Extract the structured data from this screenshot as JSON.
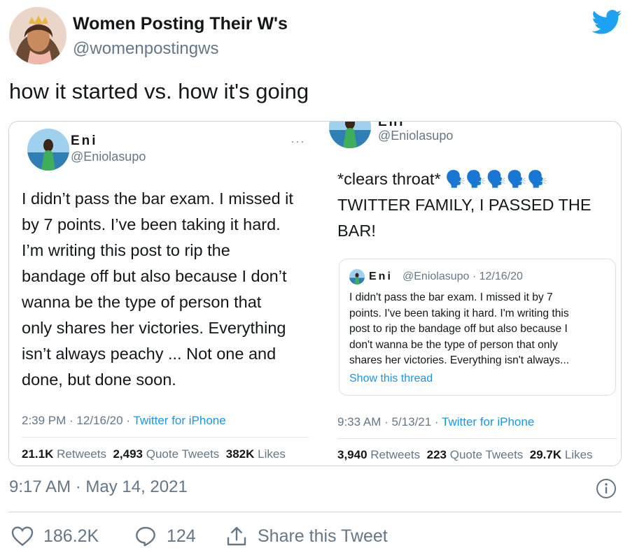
{
  "author": {
    "name": "Women Posting Their W's",
    "handle": "@womenpostingws"
  },
  "tweet": {
    "text": "how it started vs. how it's going",
    "timestamp": "9:17 AM · May 14, 2021"
  },
  "actions": {
    "likes": "186.2K",
    "replies": "124",
    "share_label": "Share this Tweet"
  },
  "left_shot": {
    "name": "Eni",
    "handle": "@Eniolasupo",
    "more": "···",
    "lines": [
      "I didn’t pass the bar exam. I missed it",
      "by 7 points. I’ve been taking it hard.",
      "I’m writing this post to rip the",
      "bandage off but also because I don’t",
      "wanna be the type of person that",
      "only shares her victories. Everything",
      "isn’t always peachy ... Not one and",
      "done, but done soon."
    ],
    "time": "2:39 PM · 12/16/20 · ",
    "via": "Twitter for iPhone",
    "retweets": "21.1K",
    "retweets_label": "Retweets",
    "quotes": "2,493",
    "quotes_label": "Quote Tweets",
    "likes": "382K",
    "likes_label": "Likes"
  },
  "right_shot": {
    "name": "Eni",
    "handle": "@Eniolasupo",
    "lines": [
      "*clears throat* 🗣️🗣️🗣️🗣️🗣️",
      "TWITTER FAMILY, I PASSED THE",
      "BAR!"
    ],
    "quote": {
      "name": "Eni",
      "handle_date": "@Eniolasupo · 12/16/20",
      "lines": [
        "I didn't pass the bar exam. I missed it by 7",
        "points. I've been taking it hard. I'm writing this",
        "post to rip the bandage off but also because I",
        "don't wanna be the type of person that only",
        "shares her victories. Everything isn't always..."
      ],
      "link": "Show this thread"
    },
    "time": "9:33 AM · 5/13/21 · ",
    "via": "Twitter for iPhone",
    "retweets": "3,940",
    "retweets_label": "Retweets",
    "quotes": "223",
    "quotes_label": "Quote Tweets",
    "likes": "29.7K",
    "likes_label": "Likes"
  },
  "colors": {
    "brand": "#1da1f2",
    "link": "#1b95e0",
    "secondary_text": "#657786"
  }
}
